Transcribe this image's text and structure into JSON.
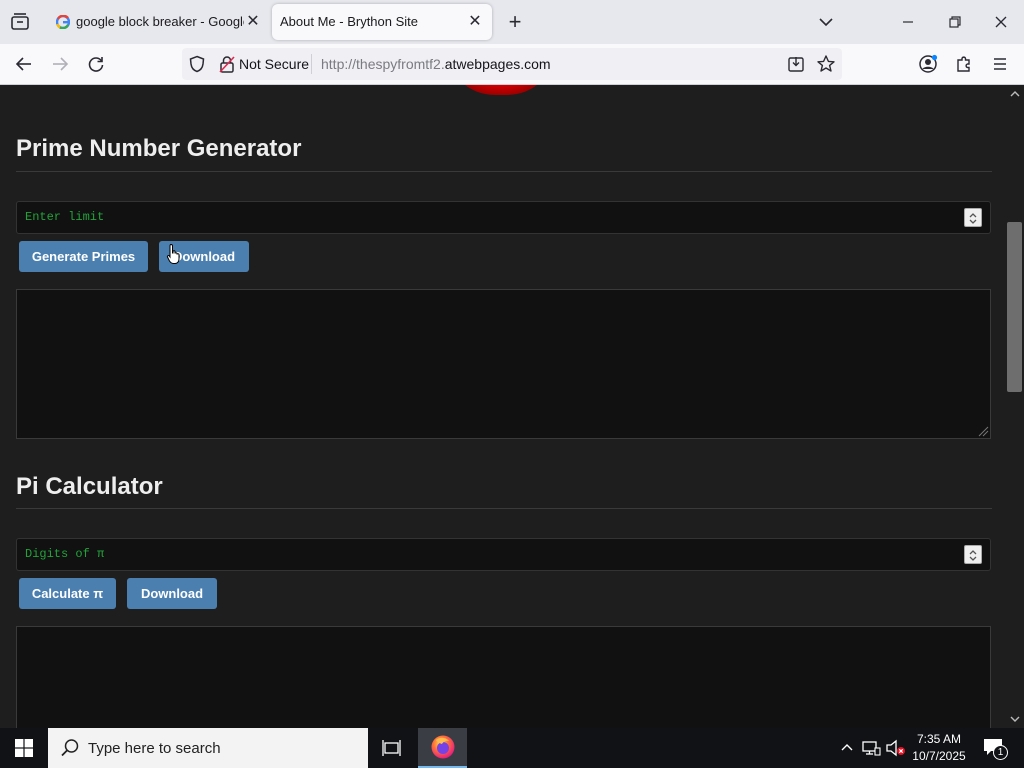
{
  "browser": {
    "tabs": [
      {
        "title": "google block breaker - Google",
        "active": false
      },
      {
        "title": "About Me - Brython Site",
        "active": true
      }
    ],
    "security_label": "Not Secure",
    "url_prefix": "http://thespyfromtf2.",
    "url_domain": "atwebpages.com"
  },
  "page": {
    "prime": {
      "title": "Prime Number Generator",
      "input_placeholder": "Enter limit",
      "generate_label": "Generate Primes",
      "download_label": "Download"
    },
    "pi": {
      "title": "Pi Calculator",
      "input_placeholder": "Digits of π",
      "calculate_label": "Calculate π",
      "download_label": "Download"
    }
  },
  "taskbar": {
    "search_placeholder": "Type here to search",
    "time": "7:35 AM",
    "date": "10/7/2025",
    "notification_count": "1"
  },
  "colors": {
    "accent_button": "#4a7fb0",
    "input_text": "#22a33a",
    "page_bg": "#1e1e1e"
  }
}
